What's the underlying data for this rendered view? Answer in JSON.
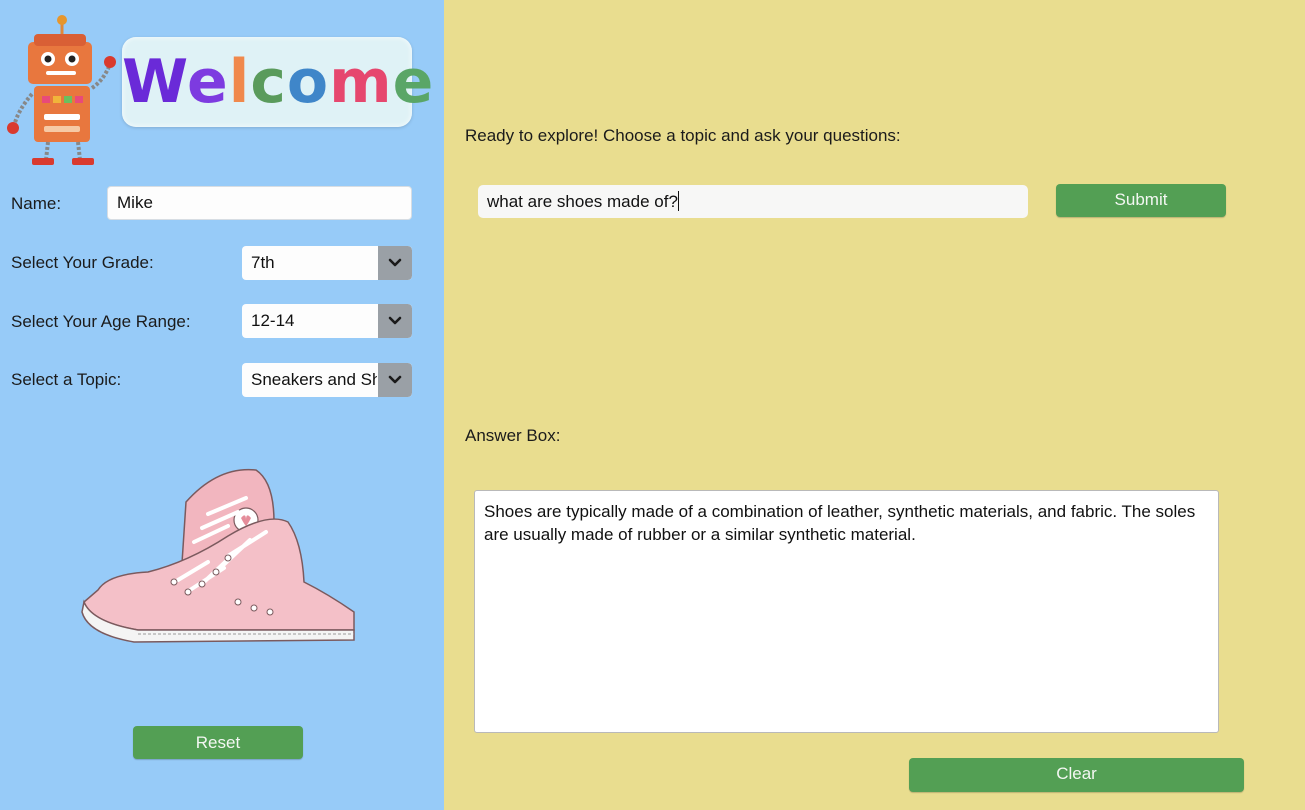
{
  "sidebar": {
    "welcome_title": "Welcome",
    "name_label": "Name:",
    "name_value": "Mike",
    "grade_label": "Select Your Grade:",
    "grade_value": "7th",
    "age_label": "Select Your Age Range:",
    "age_value": "12-14",
    "topic_label": "Select a Topic:",
    "topic_value": "Sneakers and Shoes",
    "reset_label": "Reset"
  },
  "main": {
    "prompt": "Ready to explore! Choose a topic and ask your questions:",
    "question_value": "what are shoes made of?",
    "submit_label": "Submit",
    "answer_label": "Answer Box:",
    "answer_text": "Shoes are typically made of a combination of leather, synthetic materials, and fabric. The soles are usually made of rubber or a similar synthetic material.",
    "clear_label": "Clear"
  },
  "colors": {
    "sidebar_bg": "#97cbf8",
    "main_bg": "#e9dd8f",
    "button_green": "#539f54"
  },
  "icons": [
    "robot-mascot",
    "sneakers-illustration",
    "chevron-down-icon"
  ]
}
